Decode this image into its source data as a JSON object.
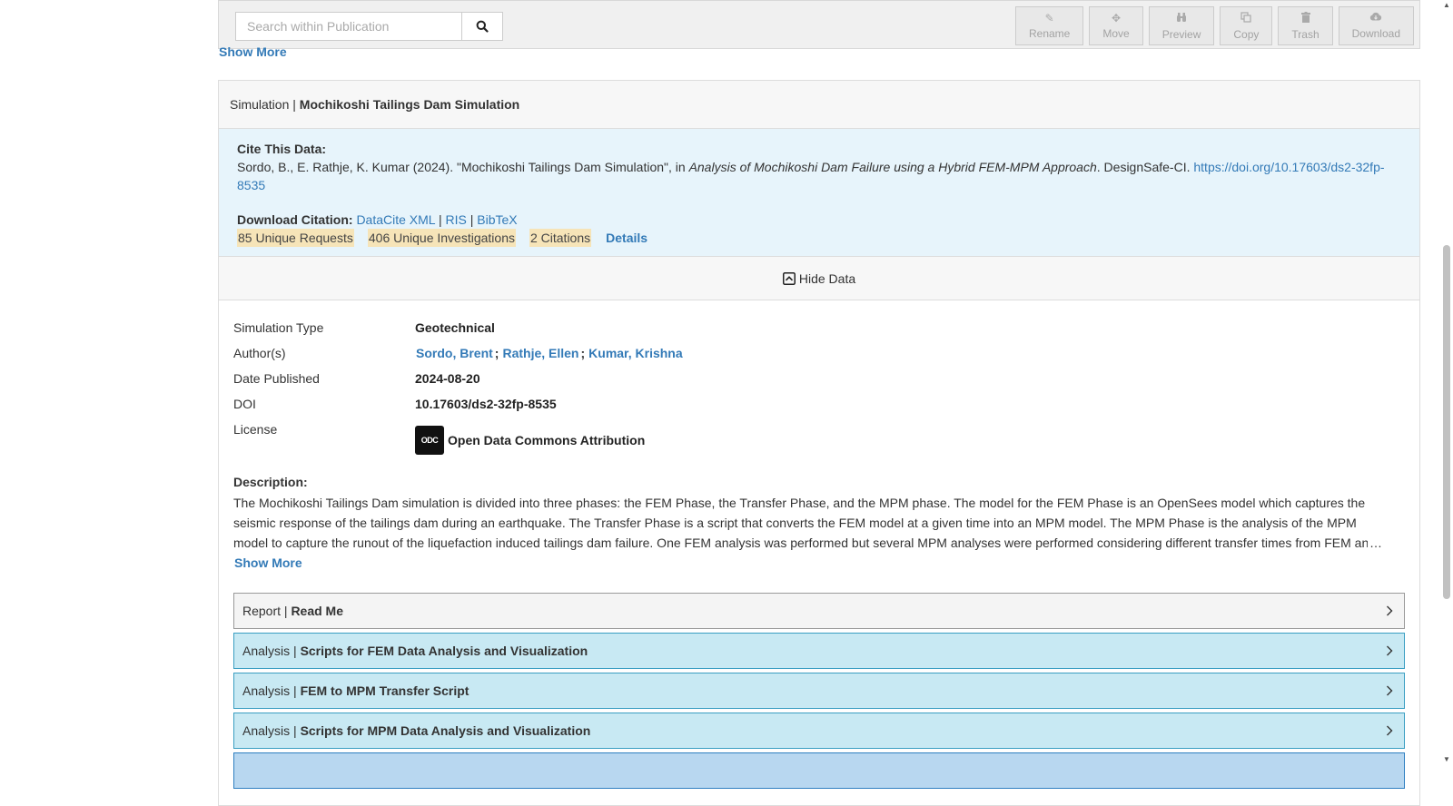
{
  "toolbar": {
    "search_placeholder": "Search within Publication",
    "buttons": [
      {
        "label": "Rename",
        "icon": "pencil-icon"
      },
      {
        "label": "Move",
        "icon": "move-icon"
      },
      {
        "label": "Preview",
        "icon": "binoculars-icon"
      },
      {
        "label": "Copy",
        "icon": "copy-icon"
      },
      {
        "label": "Trash",
        "icon": "trash-icon"
      },
      {
        "label": "Download",
        "icon": "cloud-download-icon"
      }
    ]
  },
  "top_show_more": "Show More",
  "simulation": {
    "type_prefix": "Simulation |",
    "title": "Mochikoshi Tailings Dam Simulation",
    "cite_label": "Cite This Data:",
    "cite_part1": "Sordo, B., E. Rathje, K. Kumar (2024). \"Mochikoshi Tailings Dam Simulation\", in ",
    "cite_italic": "Analysis of Mochikoshi Dam Failure using a Hybrid FEM-MPM Approach",
    "cite_part2": ". DesignSafe-CI. ",
    "cite_doi_link": "https://doi.org/10.17603/ds2-32fp-8535",
    "download_label": "Download Citation:",
    "download_links": [
      "DataCite XML",
      "RIS",
      "BibTeX"
    ],
    "download_sep": "|",
    "metrics": [
      "85 Unique Requests",
      "406 Unique Investigations",
      "2 Citations"
    ],
    "details_label": "Details",
    "hide_data_label": "Hide Data",
    "fields": {
      "sim_type_label": "Simulation Type",
      "sim_type_value": "Geotechnical",
      "authors_label": "Author(s)",
      "authors": [
        "Sordo, Brent",
        "Rathje, Ellen",
        "Kumar, Krishna"
      ],
      "author_sep": ";",
      "date_label": "Date Published",
      "date_value": "2024-08-20",
      "doi_label": "DOI",
      "doi_value": "10.17603/ds2-32fp-8535",
      "license_label": "License",
      "license_icon_text": "ODC",
      "license_value": "Open Data Commons Attribution"
    },
    "description_label": "Description:",
    "description": "The Mochikoshi Tailings Dam simulation is divided into three phases: the FEM Phase, the Transfer Phase, and the MPM phase. The model for the FEM Phase is an OpenSees model which captures the seismic response of the tailings dam during an earthquake. The Transfer Phase is a script that converts the FEM model at a given time into an MPM model. The MPM Phase is the analysis of the MPM model to capture the runout of the liquefaction induced tailings dam failure. One FEM analysis was performed but several MPM analyses were performed considering different transfer times from FEM and different",
    "desc_show_more": "Show More",
    "sections": [
      {
        "type": "Report |",
        "title": "Read Me",
        "style": "report"
      },
      {
        "type": "Analysis |",
        "title": "Scripts for FEM Data Analysis and Visualization",
        "style": "analysis"
      },
      {
        "type": "Analysis |",
        "title": "FEM to MPM Transfer Script",
        "style": "analysis"
      },
      {
        "type": "Analysis |",
        "title": "Scripts for MPM Data Analysis and Visualization",
        "style": "analysis"
      }
    ]
  }
}
